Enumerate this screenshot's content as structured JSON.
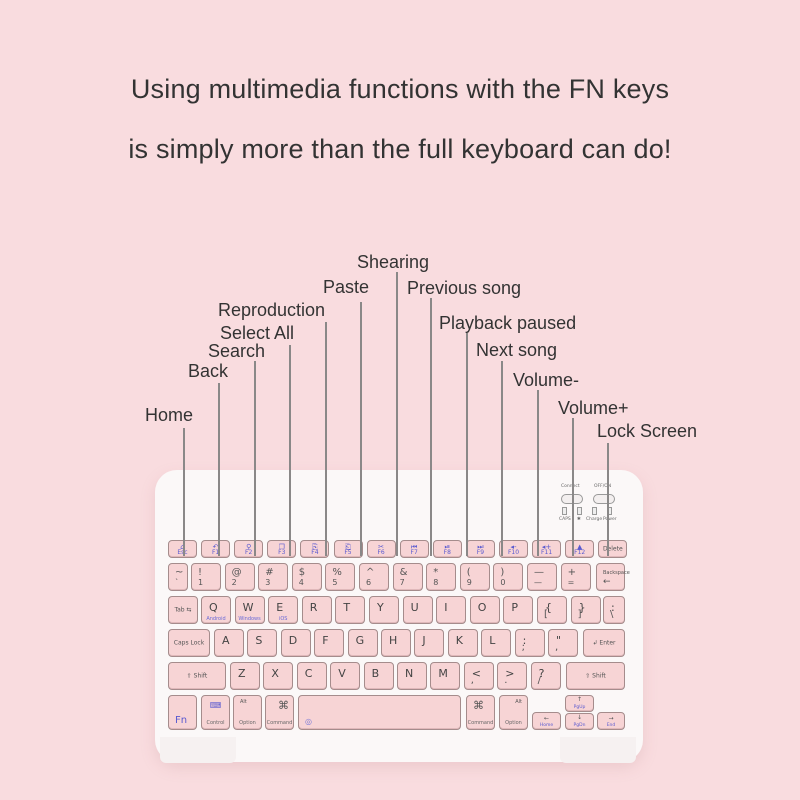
{
  "headline": {
    "line1": "Using multimedia functions with the FN keys",
    "line2": "is simply more than the full keyboard can do!"
  },
  "callouts": [
    {
      "id": "home",
      "text": "Home",
      "key": "Esc"
    },
    {
      "id": "back",
      "text": "Back",
      "key": "F1"
    },
    {
      "id": "search",
      "text": "Search",
      "key": "F2"
    },
    {
      "id": "select-all",
      "text": "Select All",
      "key": "F3"
    },
    {
      "id": "reproduction",
      "text": "Reproduction",
      "key": "F4"
    },
    {
      "id": "paste",
      "text": "Paste",
      "key": "F5"
    },
    {
      "id": "shearing",
      "text": "Shearing",
      "key": "F6"
    },
    {
      "id": "previous-song",
      "text": "Previous song",
      "key": "F7"
    },
    {
      "id": "playback-paused",
      "text": "Playback paused",
      "key": "F8"
    },
    {
      "id": "next-song",
      "text": "Next song",
      "key": "F9"
    },
    {
      "id": "volume-down",
      "text": "Volume-",
      "key": "F11"
    },
    {
      "id": "volume-up",
      "text": "Volume+",
      "key": "F12"
    },
    {
      "id": "lock-screen",
      "text": "Lock Screen",
      "key": "Delete"
    }
  ],
  "indicators": {
    "connect": "Connect",
    "power_switch": "OFF/ON",
    "leds": [
      "CAPS",
      "✱",
      "Charge",
      "Power"
    ]
  },
  "function_row": [
    {
      "label": "Esc",
      "icon": "⌂",
      "icon_name": "home-icon"
    },
    {
      "label": "F1",
      "icon": "↶",
      "icon_name": "back-icon"
    },
    {
      "label": "F2",
      "icon": "⚲",
      "icon_name": "search-icon"
    },
    {
      "label": "F3",
      "icon": "❐",
      "icon_name": "select-all-icon"
    },
    {
      "label": "F4",
      "icon": "⎘",
      "icon_name": "copy-icon"
    },
    {
      "label": "F5",
      "icon": "⎗",
      "icon_name": "paste-icon"
    },
    {
      "label": "F6",
      "icon": "✂",
      "icon_name": "cut-icon"
    },
    {
      "label": "F7",
      "icon": "⏮",
      "icon_name": "previous-track-icon"
    },
    {
      "label": "F8",
      "icon": "⏯",
      "icon_name": "play-pause-icon"
    },
    {
      "label": "F9",
      "icon": "⏭",
      "icon_name": "next-track-icon"
    },
    {
      "label": "F10",
      "icon": "◂-",
      "icon_name": "volume-mute-icon"
    },
    {
      "label": "F11",
      "icon": "◂+",
      "icon_name": "volume-down-icon"
    },
    {
      "label": "F12",
      "icon": "▲",
      "icon_name": "lock-icon"
    },
    {
      "label": "Delete",
      "icon": "",
      "icon_name": ""
    }
  ],
  "number_row": [
    {
      "top": "~",
      "bot": "`"
    },
    {
      "top": "!",
      "bot": "1"
    },
    {
      "top": "@",
      "bot": "2"
    },
    {
      "top": "#",
      "bot": "3"
    },
    {
      "top": "$",
      "bot": "4"
    },
    {
      "top": "%",
      "bot": "5"
    },
    {
      "top": "^",
      "bot": "6"
    },
    {
      "top": "&",
      "bot": "7"
    },
    {
      "top": "*",
      "bot": "8"
    },
    {
      "top": "(",
      "bot": "9"
    },
    {
      "top": ")",
      "bot": "0"
    },
    {
      "top": "—",
      "bot": "—"
    },
    {
      "top": "+",
      "bot": "="
    },
    {
      "top": "Backspace",
      "bot": "←"
    }
  ],
  "qwerty_row": [
    {
      "main": "Tab ⇆"
    },
    {
      "main": "Q",
      "sub": "Android"
    },
    {
      "main": "W",
      "sub": "Windows"
    },
    {
      "main": "E",
      "sub": "iOS"
    },
    {
      "main": "R"
    },
    {
      "main": "T"
    },
    {
      "main": "Y"
    },
    {
      "main": "U"
    },
    {
      "main": "I"
    },
    {
      "main": "O"
    },
    {
      "main": "P"
    },
    {
      "main": "{",
      "bot": "["
    },
    {
      "main": "}",
      "bot": "]"
    },
    {
      "main": ":",
      "bot": "\\"
    }
  ],
  "home_row": [
    {
      "main": "Caps Lock"
    },
    {
      "main": "A"
    },
    {
      "main": "S"
    },
    {
      "main": "D"
    },
    {
      "main": "F"
    },
    {
      "main": "G"
    },
    {
      "main": "H"
    },
    {
      "main": "J"
    },
    {
      "main": "K"
    },
    {
      "main": "L"
    },
    {
      "main": ":",
      "bot": ";"
    },
    {
      "main": "\"",
      "bot": ","
    },
    {
      "main": "↲ Enter"
    }
  ],
  "shift_row": [
    {
      "main": "⇧ Shift"
    },
    {
      "main": "Z"
    },
    {
      "main": "X"
    },
    {
      "main": "C"
    },
    {
      "main": "V"
    },
    {
      "main": "B"
    },
    {
      "main": "N"
    },
    {
      "main": "M"
    },
    {
      "main": "<",
      "bot": ","
    },
    {
      "main": ">",
      "bot": "."
    },
    {
      "main": "?",
      "bot": "/"
    },
    {
      "main": "⇧ Shift"
    }
  ],
  "bottom_row": {
    "fn": "Fn",
    "control": "Control",
    "option_left_top": "Alt",
    "option_left": "Option",
    "command_left_sym": "⌘",
    "command_left": "Command",
    "space_icon": "◎",
    "command_right_sym": "⌘",
    "command_right": "Command",
    "option_right_top": "Alt",
    "option_right": "Option",
    "arrow_left": "←",
    "home": "Home",
    "arrow_up": "↑",
    "pgup": "PgUp",
    "arrow_down": "↓",
    "pgdn": "PgDn",
    "arrow_right": "→",
    "end": "End"
  }
}
